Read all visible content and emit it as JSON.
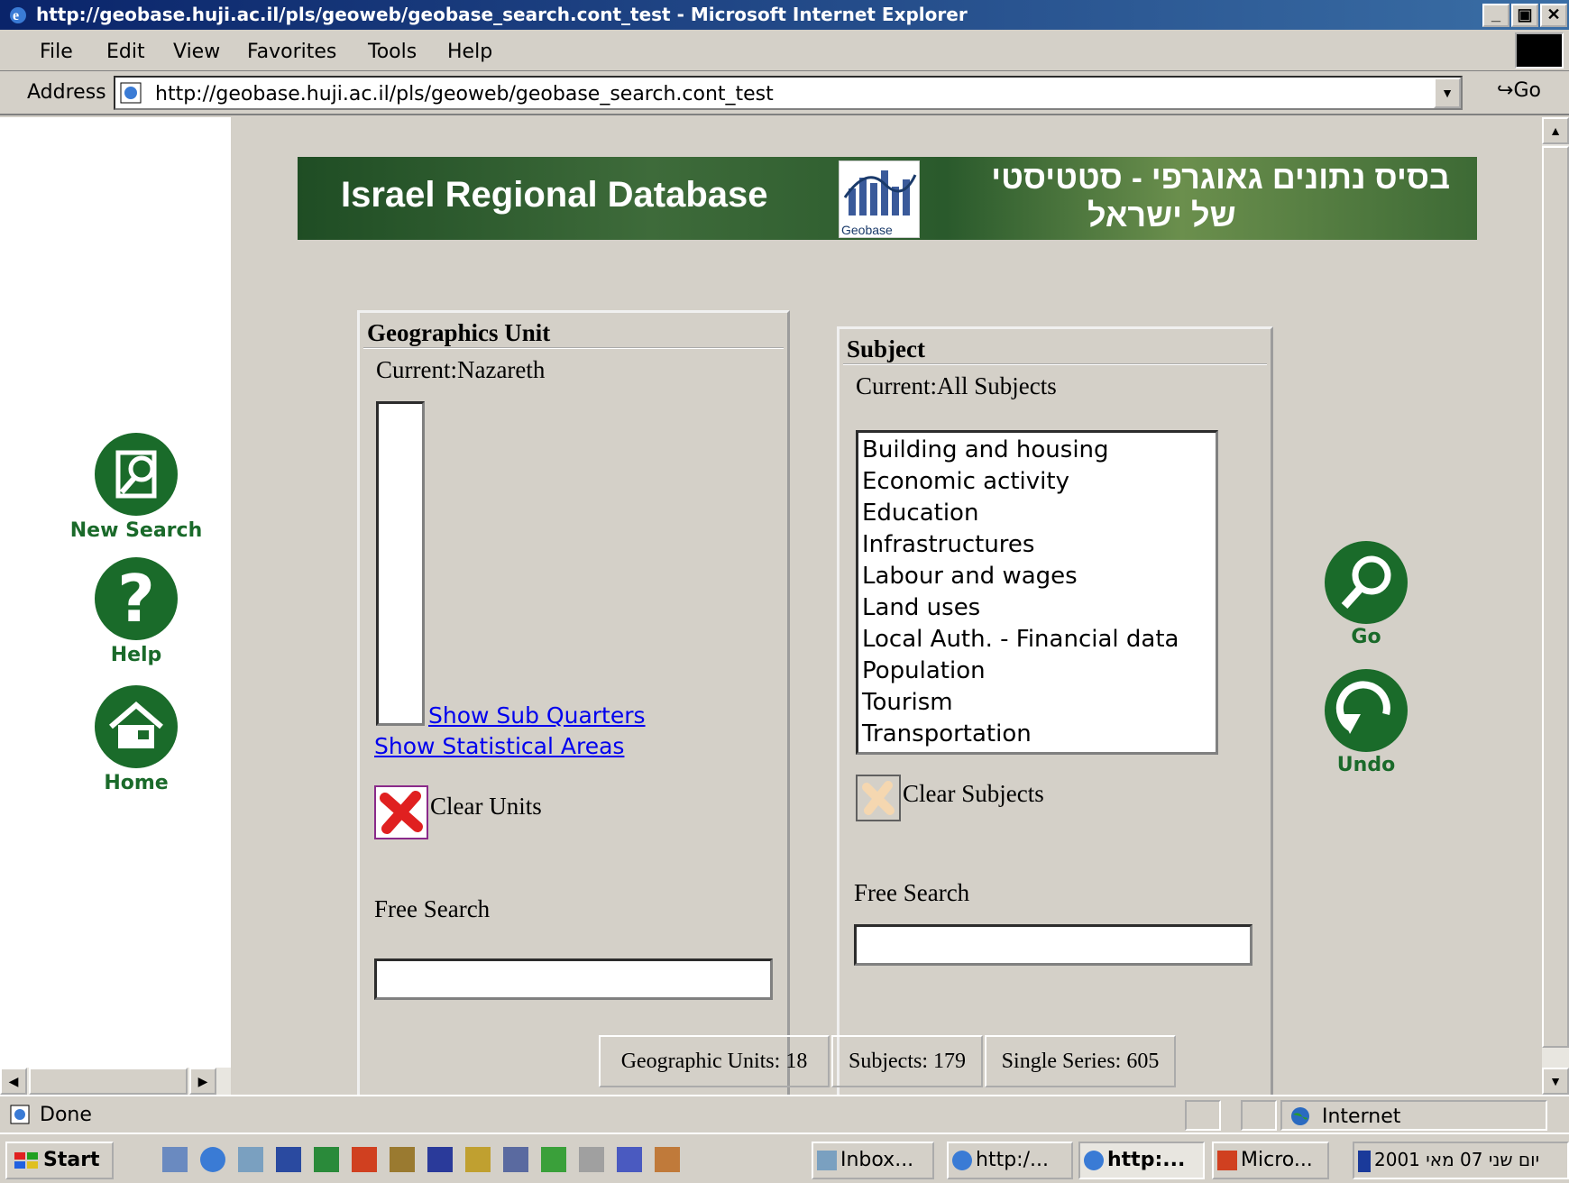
{
  "window": {
    "title": "http://geobase.huji.ac.il/pls/geoweb/geobase_search.cont_test - Microsoft Internet Explorer",
    "min_label": "_",
    "max_label": "🗗",
    "close_label": "✕"
  },
  "menu": [
    "File",
    "Edit",
    "View",
    "Favorites",
    "Tools",
    "Help"
  ],
  "address": {
    "label": "Address",
    "url": "http://geobase.huji.ac.il/pls/geoweb/geobase_search.cont_test",
    "go_label": "Go"
  },
  "banner": {
    "title_en": "Israel Regional Database",
    "title_he_1": "בסיס נתונים גאוגרפי - סטטיסטי",
    "title_he_2": "של ישראל",
    "logo_text": "Geobase"
  },
  "nav": {
    "new_search": "New Search",
    "help": "Help",
    "home": "Home",
    "go": "Go",
    "undo": "Undo"
  },
  "geo_panel": {
    "heading": "Geographics Unit",
    "current": "Current:Nazareth",
    "show_sub_quarters": "Show Sub Quarters",
    "show_statistical_areas": "Show Statistical Areas",
    "clear_units": "Clear Units",
    "free_search_label": "Free Search",
    "free_search_value": ""
  },
  "subject_panel": {
    "heading": "Subject",
    "current": "Current:All Subjects",
    "subjects": [
      "Building and housing",
      "Economic activity",
      "Education",
      "Infrastructures",
      "Labour and wages",
      "Land uses",
      "Local Auth. - Financial data",
      "Population",
      "Tourism",
      "Transportation"
    ],
    "clear_subjects": "Clear Subjects",
    "free_search_label": "Free Search",
    "free_search_value": ""
  },
  "counts": {
    "geographic_units": "Geographic Units: 18",
    "subjects": "Subjects: 179",
    "single_series": "Single Series: 605"
  },
  "status": {
    "text": "Done",
    "zone": "Internet"
  },
  "taskbar": {
    "start": "Start",
    "tasks": [
      "Inbox...",
      "http:/...",
      "http:...",
      "Micro..."
    ],
    "clock": "יום שני 07 מאי 2001"
  }
}
